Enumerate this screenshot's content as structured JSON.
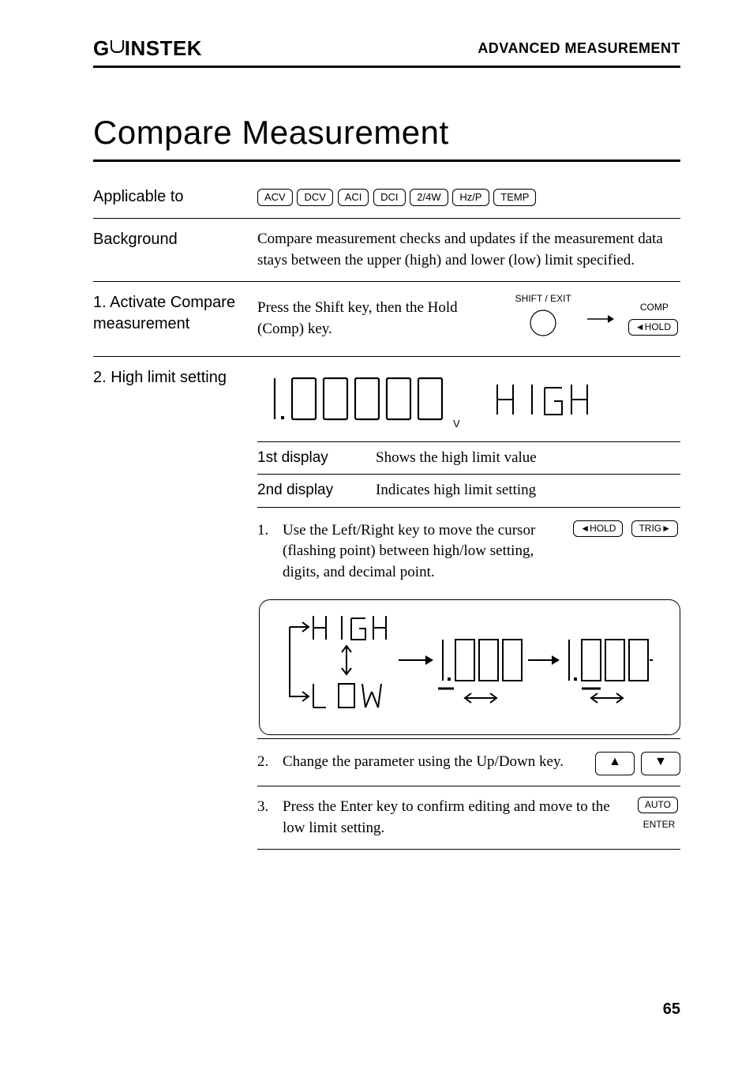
{
  "header": {
    "logo_prefix": "G",
    "logo_suffix": "INSTEK",
    "right": "ADVANCED MEASUREMENT"
  },
  "title": "Compare Measurement",
  "applicable": {
    "label": "Applicable to",
    "keys": [
      "ACV",
      "DCV",
      "ACI",
      "DCI",
      "2/4W",
      "Hz/P",
      "TEMP"
    ]
  },
  "background": {
    "label": "Background",
    "text": "Compare measurement checks and updates if the measurement data stays between the upper (high) and lower (low) limit specified."
  },
  "activate": {
    "label": "1. Activate Compare measurement",
    "text": "Press the Shift key, then the Hold (Comp) key.",
    "shift_label": "SHIFT / EXIT",
    "comp_label": "COMP",
    "hold_label": "◄HOLD"
  },
  "highlimit": {
    "label": "2. High limit setting",
    "main_reading": "1.00000",
    "unit": "V",
    "secondary": "H IGH",
    "row1_label": "1st display",
    "row1_text": "Shows the high limit value",
    "row2_label": "2nd display",
    "row2_text": "Indicates high limit setting"
  },
  "steps": {
    "s1": {
      "num": "1.",
      "text": "Use the Left/Right key to move the cursor (flashing point) between high/low setting, digits, and decimal point.",
      "key_left": "◄HOLD",
      "key_right": "TRIG►"
    },
    "diagram": {
      "high": "H IGH",
      "low": "L OW",
      "big1": "1.000",
      "big2": "1.000"
    },
    "s2": {
      "num": "2.",
      "text": "Change the parameter using the Up/Down key."
    },
    "s3": {
      "num": "3.",
      "text": "Press the Enter key to confirm editing and move to the low limit setting.",
      "key_auto": "AUTO",
      "key_enter": "ENTER"
    }
  },
  "page_number": "65"
}
